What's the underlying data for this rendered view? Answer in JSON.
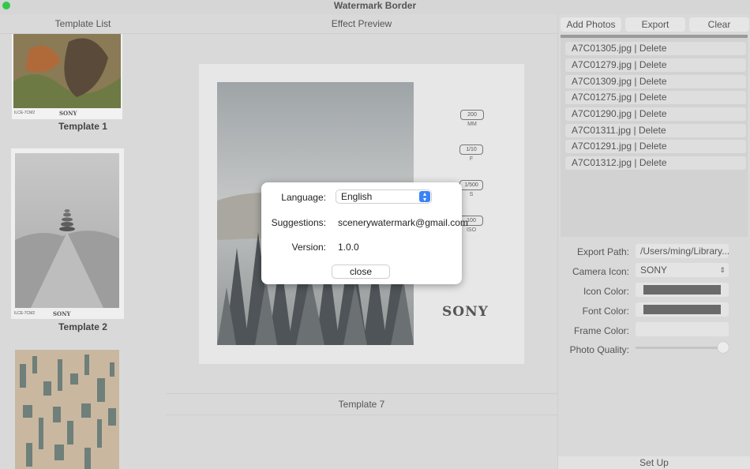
{
  "window": {
    "title": "Watermark Border"
  },
  "left": {
    "header": "Template List",
    "templates": [
      {
        "label": "Template 1",
        "model": "ILCE-7CM2",
        "brand": "SONY"
      },
      {
        "label": "Template 2",
        "model": "ILCE-7CM2",
        "brand": "SONY"
      }
    ]
  },
  "middle": {
    "header": "Effect Preview",
    "specs": [
      {
        "value": "200",
        "unit": "MM"
      },
      {
        "value": "1/10",
        "unit": "F"
      },
      {
        "value": "1/500",
        "unit": "S"
      },
      {
        "value": "100",
        "unit": "ISO"
      }
    ],
    "brand": "SONY",
    "footer": "Template 7"
  },
  "right": {
    "buttons": {
      "add": "Add Photos",
      "export": "Export",
      "clear": "Clear"
    },
    "files": [
      "A7C01305.jpg | Delete",
      "A7C01279.jpg | Delete",
      "A7C01309.jpg | Delete",
      "A7C01275.jpg | Delete",
      "A7C01290.jpg | Delete",
      "A7C01311.jpg | Delete",
      "A7C01291.jpg | Delete",
      "A7C01312.jpg | Delete"
    ],
    "settings": {
      "export_path_label": "Export Path:",
      "export_path_value": "/Users/ming/Library...",
      "camera_icon_label": "Camera Icon:",
      "camera_icon_value": "SONY",
      "icon_color_label": "Icon Color:",
      "font_color_label": "Font Color:",
      "frame_color_label": "Frame Color:",
      "photo_quality_label": "Photo Quality:",
      "photo_quality_level": 1.0
    },
    "setup": "Set Up"
  },
  "dialog": {
    "language_label": "Language:",
    "language_value": "English",
    "suggestions_label": "Suggestions:",
    "suggestions_value": "scenerywatermark@gmail.com",
    "version_label": "Version:",
    "version_value": "1.0.0",
    "close": "close"
  },
  "colors": {
    "icon_color": "#6a6a6a",
    "font_color": "#6a6a6a",
    "frame_color": "#e4e4e4",
    "accent": "#3b82f6"
  }
}
